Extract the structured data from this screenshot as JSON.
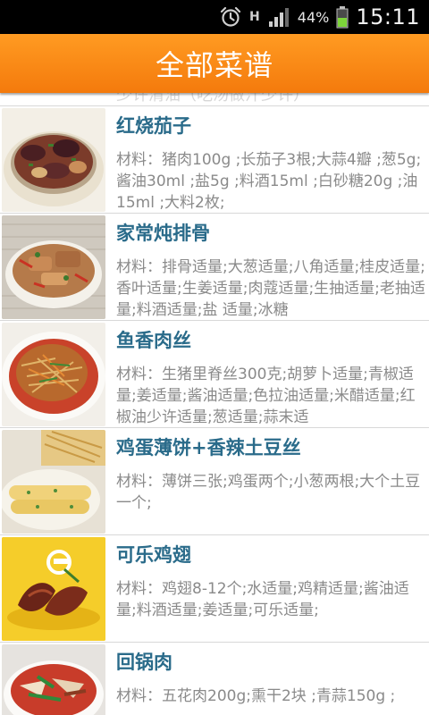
{
  "status_bar": {
    "network": "H",
    "battery_percent": "44%",
    "time": "15:11",
    "icons": [
      "alarm-icon",
      "signal-icon",
      "battery-icon"
    ]
  },
  "header": {
    "title": "全部菜谱"
  },
  "list": {
    "partial_top_text": "少许清油（吃汤做汁少许）",
    "items": [
      {
        "name": "红烧茄子",
        "materials": "材料：猪肉100g ;长茄子3根;大蒜4瓣 ;葱5g;酱油30ml ;盐5g ;料酒15ml ;白砂糖20g ;油15ml ;大料2枚;"
      },
      {
        "name": "家常炖排骨",
        "materials": "材料：排骨适量;大葱适量;八角适量;桂皮适量;香叶适量;生姜适量;肉蔻适量;生抽适量;老抽适量;料酒适量;盐 适量;冰糖"
      },
      {
        "name": "鱼香肉丝",
        "materials": "材料：生猪里脊丝300克;胡萝卜适量;青椒适量;姜适量;酱油适量;色拉油适量;米醋适量;红椒油少许适量;葱适量;蒜末适"
      },
      {
        "name": "鸡蛋薄饼+香辣土豆丝",
        "materials": "材料：薄饼三张;鸡蛋两个;小葱两根;大个土豆一个;"
      },
      {
        "name": "可乐鸡翅",
        "materials": "材料：鸡翅8-12个;水适量;鸡精适量;酱油适量;料酒适量;姜适量;可乐适量;"
      },
      {
        "name": "回锅肉",
        "materials": "材料：五花肉200g;熏干2块 ;青蒜150g ;"
      }
    ]
  }
}
